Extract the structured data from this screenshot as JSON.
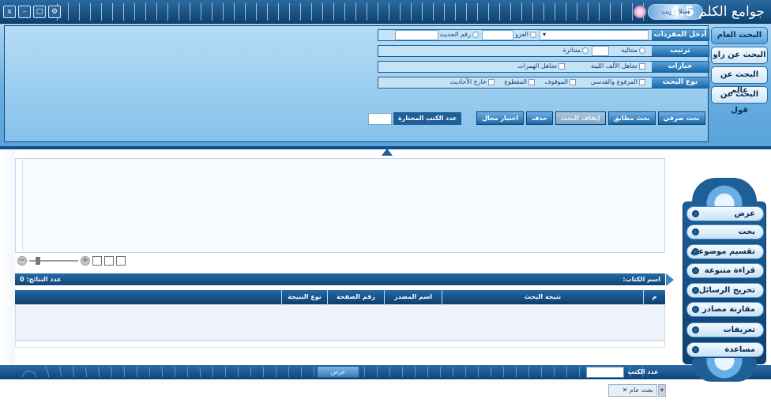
{
  "title": {
    "app_name": "جوامع الكلم",
    "version": "4.5",
    "logo_text": "إسلام ويب"
  },
  "window_buttons": [
    "x",
    "–",
    "□"
  ],
  "search_tabs": [
    {
      "label": "البحث العام",
      "active": true
    },
    {
      "label": "البحث عن راو",
      "active": false
    },
    {
      "label": "البحث عن عالم",
      "active": false
    },
    {
      "label": "البحث عن قول",
      "active": false
    }
  ],
  "form": {
    "rows": [
      {
        "label": "أدخل المفردات",
        "attribution_label": "العزو",
        "hadith_number_label": "رقم الحديث"
      },
      {
        "label": "ترتيب",
        "options": [
          "متتالية",
          "متناثرة"
        ]
      },
      {
        "label": "خيارات",
        "options": [
          "تجاهل الألف اللينة",
          "تجاهل الهمزات"
        ]
      },
      {
        "label": "نوع البحث",
        "options": [
          "المرفوع والقدسي",
          "الموقوف",
          "المقطوع",
          "خارج الأحاديث"
        ]
      }
    ],
    "buttons": [
      "بحث صرفي",
      "بحث مطابق",
      "إيقاف البحث",
      "حذف",
      "اختيار مجال"
    ],
    "selected_books_label": "عدد الكتب المختارة"
  },
  "results": {
    "book_name_label": "اسم الكتاب:",
    "results_count_label": "عدد النتائج: 0",
    "columns": [
      "م",
      "نتيجة البحث",
      "اسم المصدر",
      "رقم الصفحة",
      "نوع النتيجة"
    ]
  },
  "bottom": {
    "show_button": "عرض",
    "books_count_label": "عدد الكتب",
    "status_tab": "بحث عام"
  },
  "side_menu": [
    "عرض",
    "بحث",
    "تقسيم موضوعي",
    "قراءة متنوعة",
    "تخريج الرسائل",
    "مقارنة مصادر",
    "تعريفات",
    "مساعدة"
  ],
  "colors": {
    "primary": "#0f4676",
    "accent": "#5aa3db",
    "panel": "#b6dcf5"
  }
}
